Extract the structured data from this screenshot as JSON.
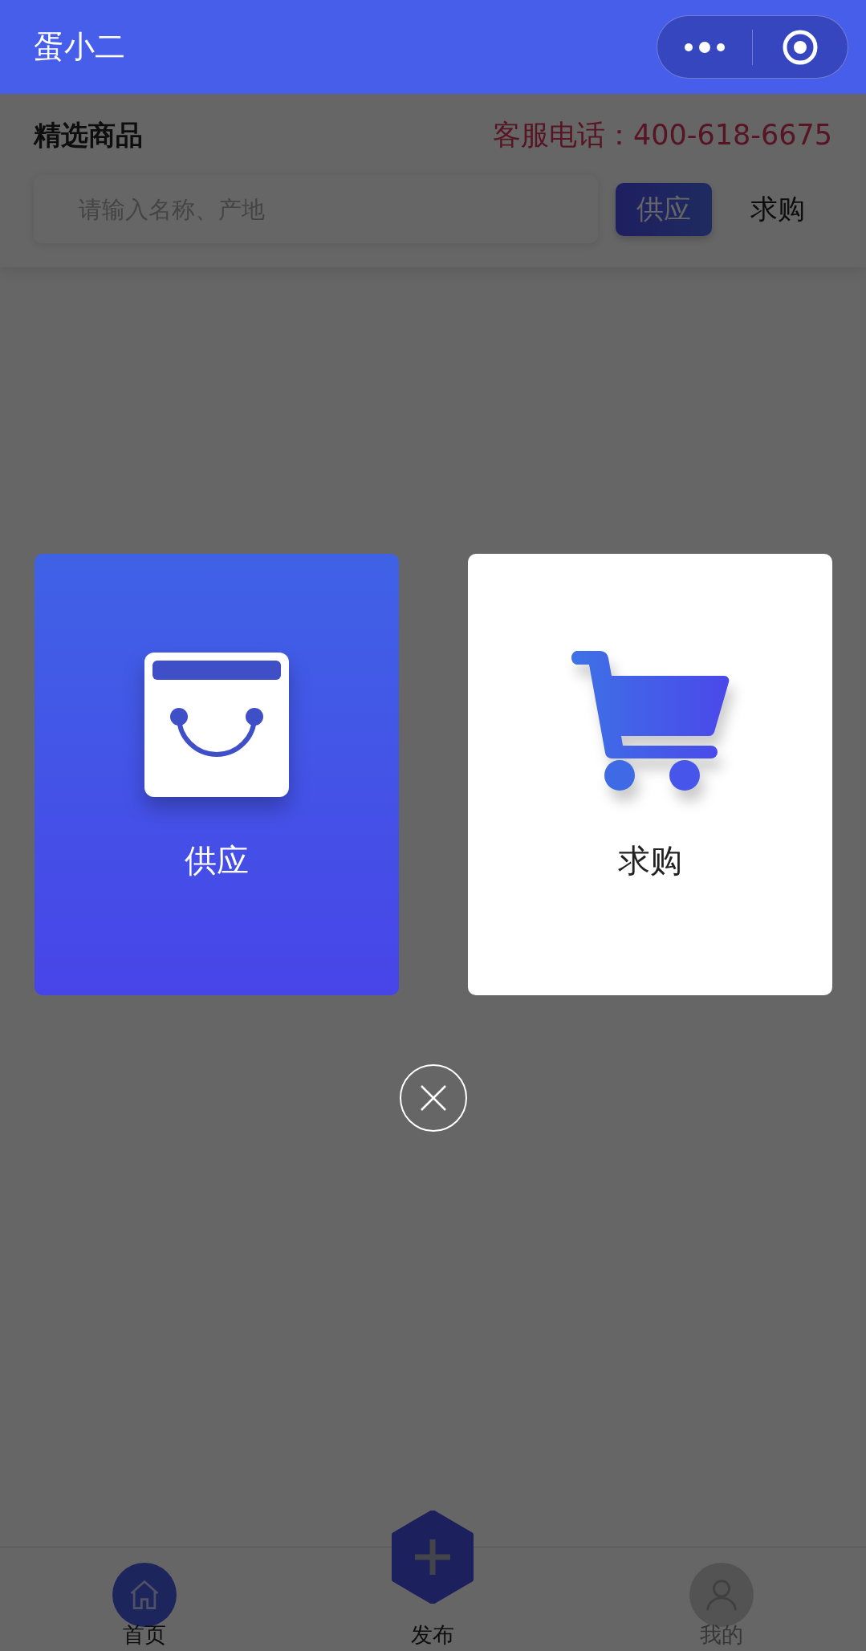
{
  "nav_bar": {
    "title": "蛋小二"
  },
  "page": {
    "heading": "精选商品",
    "hotline": "客服电话：400-618-6675",
    "search": {
      "placeholder": "请输入名称、产地"
    },
    "filter_tabs": [
      {
        "label": "供应",
        "selected": true
      },
      {
        "label": "求购",
        "selected": false
      }
    ]
  },
  "publish_modal": {
    "options": [
      {
        "label": "供应",
        "kind": "supply",
        "selected": true
      },
      {
        "label": "求购",
        "kind": "demand",
        "selected": false
      }
    ]
  },
  "tab_bar": [
    {
      "label": "首页",
      "kind": "home",
      "selected": true
    },
    {
      "label": "发布",
      "kind": "publish",
      "selected": false
    },
    {
      "label": "我的",
      "kind": "profile",
      "selected": false
    }
  ]
}
